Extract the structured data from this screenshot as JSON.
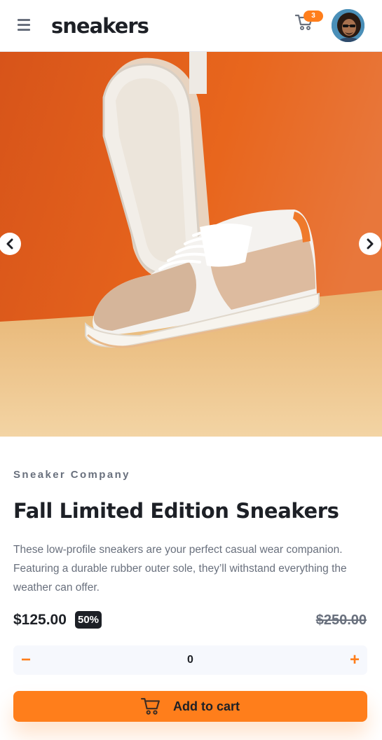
{
  "header": {
    "logo": "sneakers",
    "cart_count": "3",
    "menu_icon": "menu-icon",
    "cart_icon": "cart-icon"
  },
  "gallery": {
    "prev_icon": "chevron-left-icon",
    "next_icon": "chevron-right-icon"
  },
  "product": {
    "company": "Sneaker Company",
    "title": "Fall Limited Edition Sneakers",
    "description": "These low-profile sneakers are your perfect casual wear companion. Featuring a durable rubber outer sole, they’ll withstand everything the weather can offer.",
    "price": "$125.00",
    "discount": "50%",
    "old_price": "$250.00"
  },
  "quantity": {
    "value": "0",
    "minus_label": "−",
    "plus_label": "+"
  },
  "cta": {
    "label": "Add to cart"
  },
  "colors": {
    "accent": "#ff7e1b",
    "dark": "#1d2026",
    "grey": "#69707d",
    "light_bg": "#f6f8fd"
  }
}
